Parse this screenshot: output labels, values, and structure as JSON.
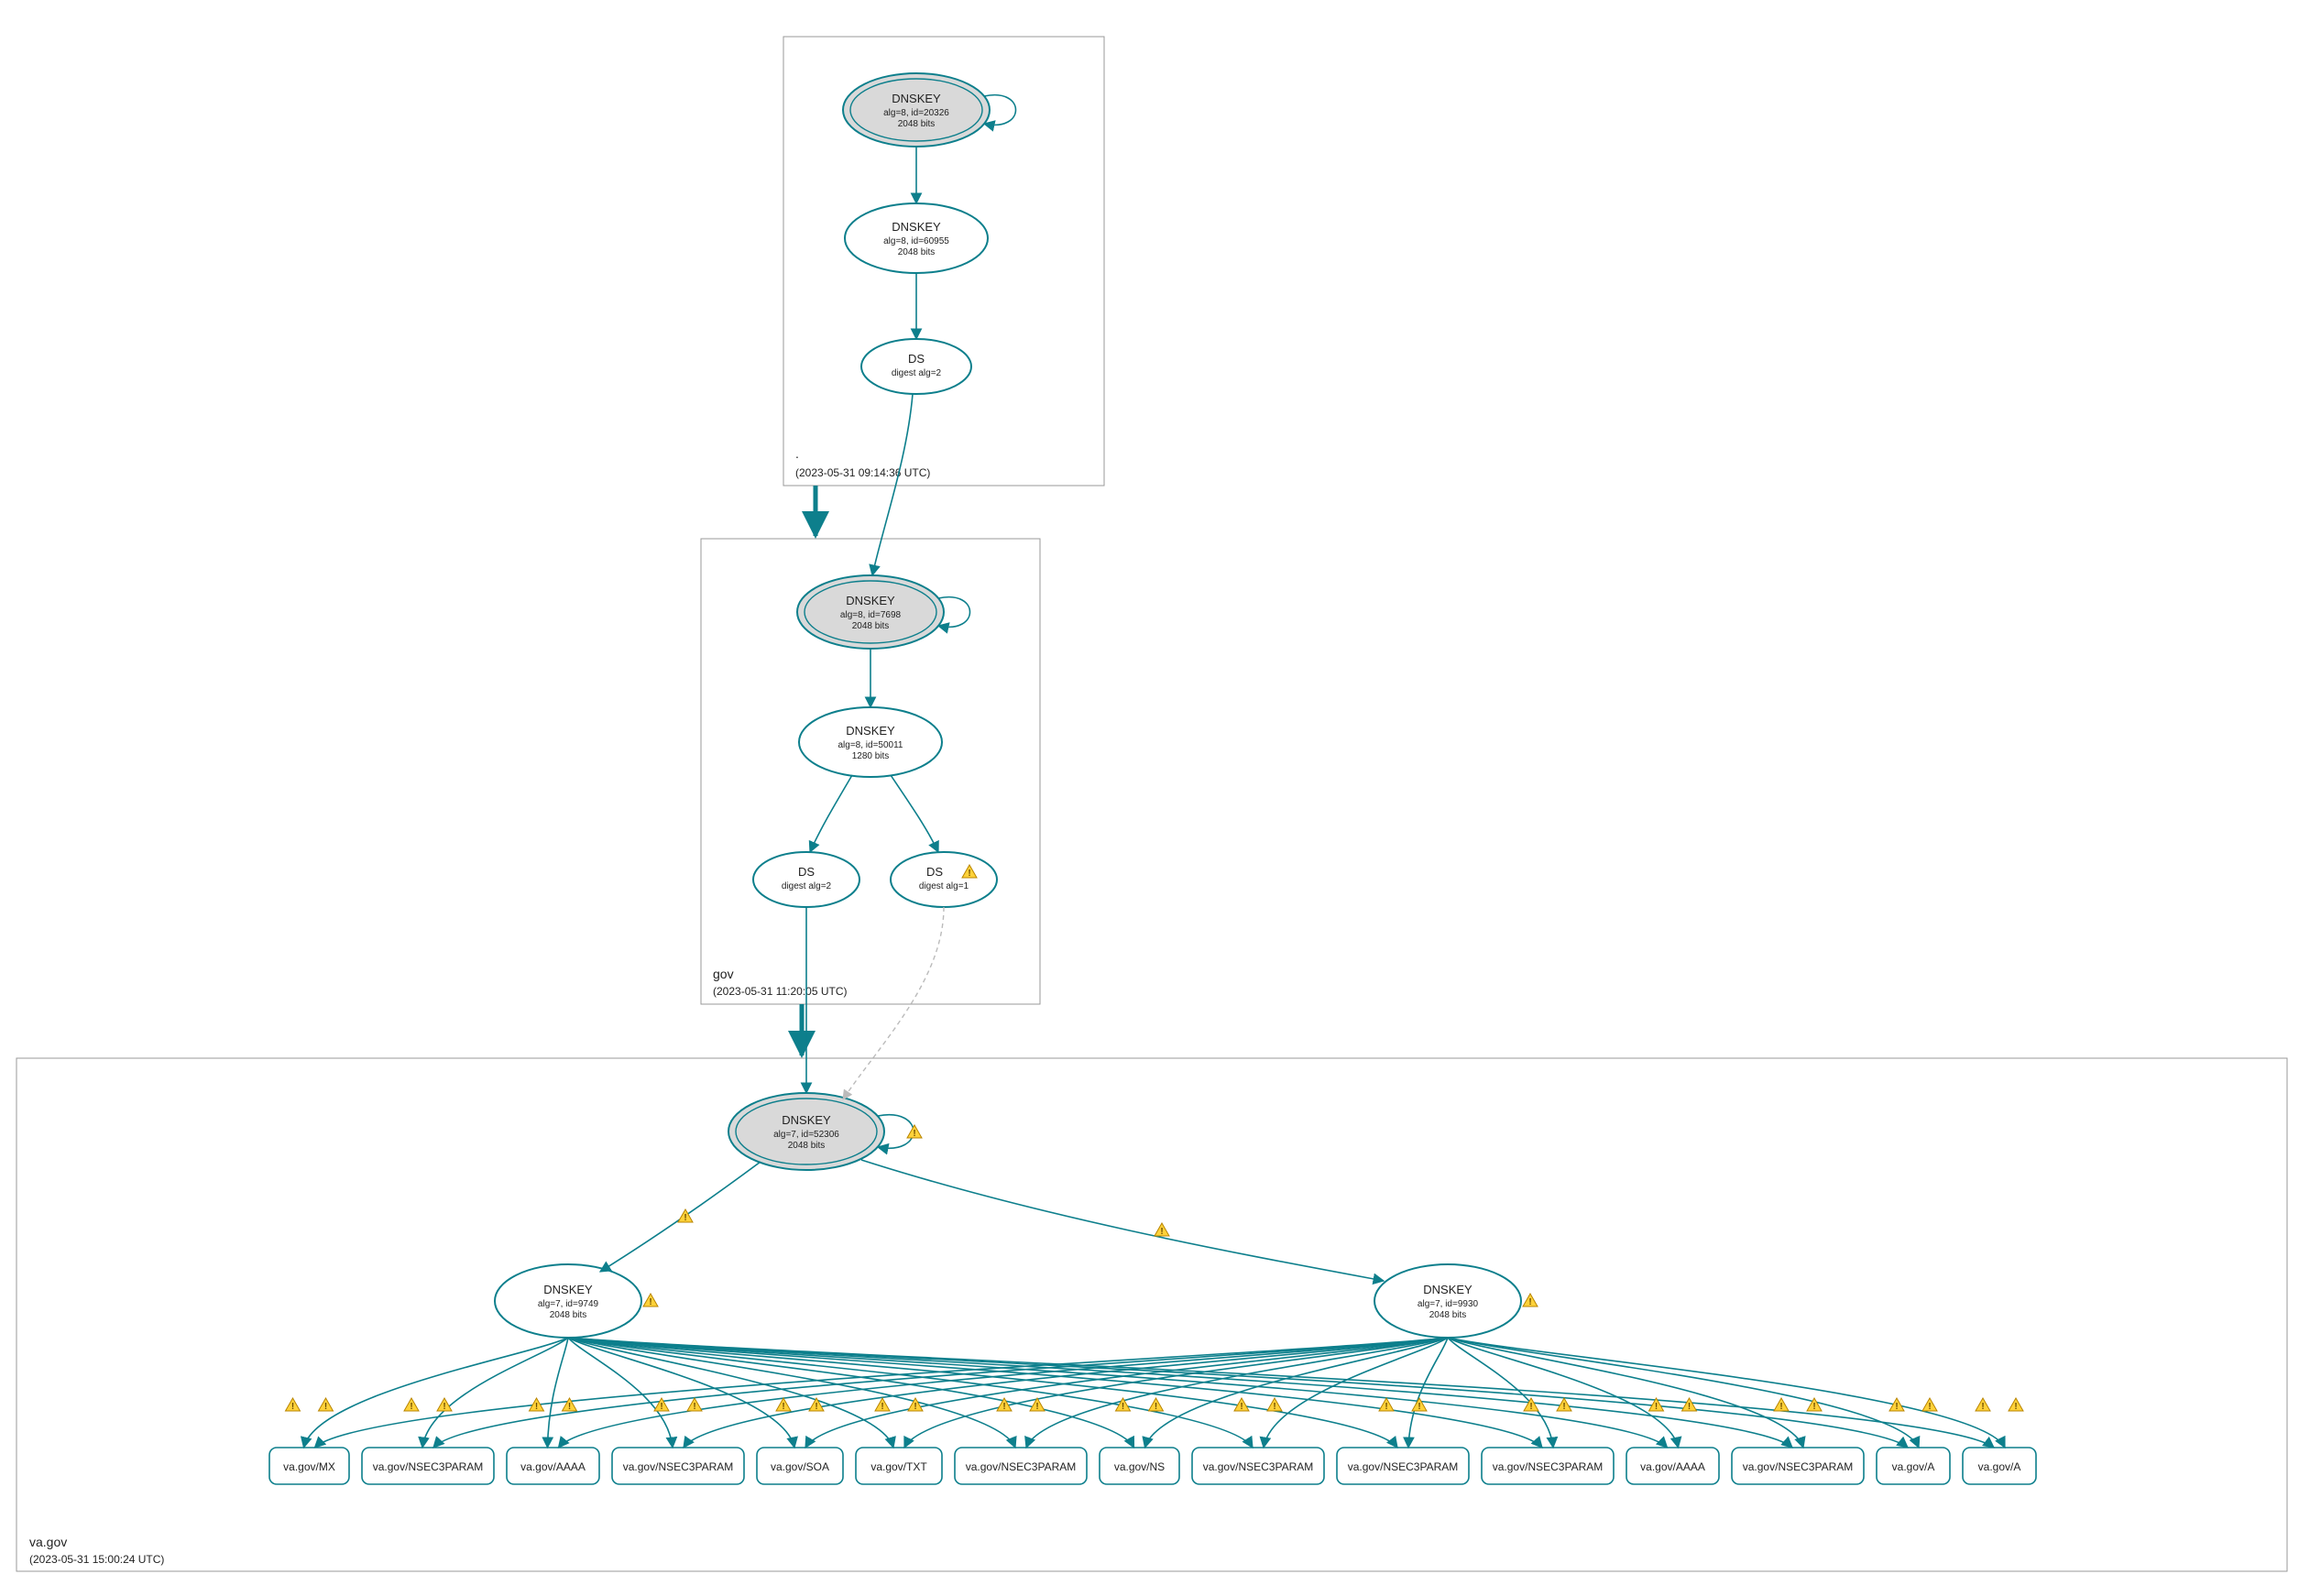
{
  "zones": {
    "root": {
      "label": ".",
      "timestamp": "(2023-05-31 09:14:36 UTC)"
    },
    "gov": {
      "label": "gov",
      "timestamp": "(2023-05-31 11:20:05 UTC)"
    },
    "vagov": {
      "label": "va.gov",
      "timestamp": "(2023-05-31 15:00:24 UTC)"
    }
  },
  "nodes": {
    "root_ksk": {
      "title": "DNSKEY",
      "line1": "alg=8, id=20326",
      "line2": "2048 bits"
    },
    "root_zsk": {
      "title": "DNSKEY",
      "line1": "alg=8, id=60955",
      "line2": "2048 bits"
    },
    "root_ds": {
      "title": "DS",
      "line1": "digest alg=2"
    },
    "gov_ksk": {
      "title": "DNSKEY",
      "line1": "alg=8, id=7698",
      "line2": "2048 bits"
    },
    "gov_zsk": {
      "title": "DNSKEY",
      "line1": "alg=8, id=50011",
      "line2": "1280 bits"
    },
    "gov_ds2": {
      "title": "DS",
      "line1": "digest alg=2"
    },
    "gov_ds1": {
      "title": "DS",
      "line1": "digest alg=1"
    },
    "va_ksk": {
      "title": "DNSKEY",
      "line1": "alg=7, id=52306",
      "line2": "2048 bits"
    },
    "va_zsk_a": {
      "title": "DNSKEY",
      "line1": "alg=7, id=9749",
      "line2": "2048 bits"
    },
    "va_zsk_b": {
      "title": "DNSKEY",
      "line1": "alg=7, id=9930",
      "line2": "2048 bits"
    }
  },
  "leaves": [
    {
      "label": "va.gov/MX"
    },
    {
      "label": "va.gov/NSEC3PARAM"
    },
    {
      "label": "va.gov/AAAA"
    },
    {
      "label": "va.gov/NSEC3PARAM"
    },
    {
      "label": "va.gov/SOA"
    },
    {
      "label": "va.gov/TXT"
    },
    {
      "label": "va.gov/NSEC3PARAM"
    },
    {
      "label": "va.gov/NS"
    },
    {
      "label": "va.gov/NSEC3PARAM"
    },
    {
      "label": "va.gov/NSEC3PARAM"
    },
    {
      "label": "va.gov/NSEC3PARAM"
    },
    {
      "label": "va.gov/AAAA"
    },
    {
      "label": "va.gov/NSEC3PARAM"
    },
    {
      "label": "va.gov/A"
    },
    {
      "label": "va.gov/A"
    }
  ]
}
